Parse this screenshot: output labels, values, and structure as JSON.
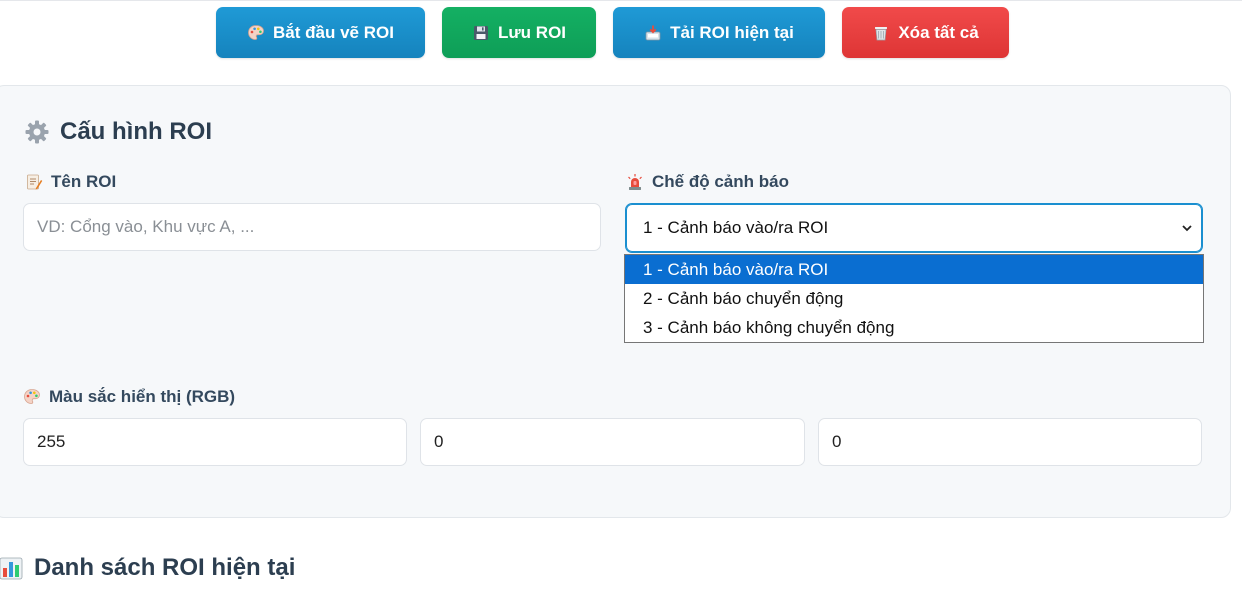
{
  "toolbar": {
    "start_draw_label": "Bắt đầu vẽ ROI",
    "save_label": "Lưu ROI",
    "load_label": "Tải ROI hiện tại",
    "clear_label": "Xóa tất cả",
    "icons": [
      "palette-icon",
      "floppy-disk-icon",
      "inbox-tray-icon",
      "wastebasket-icon"
    ]
  },
  "config": {
    "title": "Cấu hình ROI",
    "title_icon": "gear-icon",
    "name_label": "Tên ROI",
    "name_placeholder": "VD: Cổng vào, Khu vực A, ...",
    "name_value": "",
    "mode_label": "Chế độ cảnh báo",
    "mode_selected": "1 - Cảnh báo vào/ra ROI",
    "mode_options": [
      "1 - Cảnh báo vào/ra ROI",
      "2 - Cảnh báo chuyển động",
      "3 - Cảnh báo không chuyển động"
    ],
    "color_label": "Màu sắc hiển thị (RGB)",
    "color_r": "255",
    "color_g": "0",
    "color_b": "0"
  },
  "list": {
    "title": "Danh sách ROI hiện tại",
    "title_icon": "bar-chart-icon"
  },
  "colors": {
    "primary": "#1a8fd0",
    "success": "#0e9e57",
    "danger": "#e53e3e",
    "selected_option": "#0a6ed1"
  }
}
